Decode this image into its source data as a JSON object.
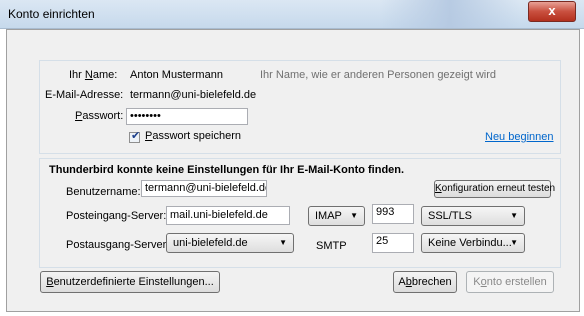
{
  "window": {
    "title": "Konto einrichten",
    "close_label": "x"
  },
  "identity": {
    "name_label_prefix": "Ihr ",
    "name_label_ul": "N",
    "name_label_rest": "ame:",
    "name_value": "Anton Mustermann",
    "name_hint": "Ihr Name, wie er anderen Personen gezeigt wird",
    "email_label": "E-Mail-Adresse:",
    "email_value": "termann@uni-bielefeld.de",
    "password_label_ul": "P",
    "password_label_rest": "asswort:",
    "password_value": "••••••••",
    "remember_label_ul": "P",
    "remember_label_rest": "asswort speichern",
    "remember_checked": true,
    "restart_link": "Neu beginnen"
  },
  "config": {
    "heading": "Thunderbird konnte keine Einstellungen für Ihr E-Mail-Konto finden.",
    "username_label": "Benutzername:",
    "username_value": "termann@uni-bielefeld.de",
    "retest_prefix": "",
    "retest_ul": "K",
    "retest_rest": "onfiguration erneut testen",
    "incoming_label": "Posteingang-Server:",
    "incoming_value": "mail.uni-bielefeld.de",
    "incoming_protocol": "IMAP",
    "incoming_port": "993",
    "incoming_security": "SSL/TLS",
    "outgoing_label": "Postausgang-Server:",
    "outgoing_value": "uni-bielefeld.de",
    "outgoing_protocol": "SMTP",
    "outgoing_port": "25",
    "outgoing_security": "Keine Verbindu..."
  },
  "footer": {
    "custom_ul": "B",
    "custom_rest": "enutzerdefinierte Einstellungen...",
    "cancel_prefix": "A",
    "cancel_ul": "b",
    "cancel_rest": "brechen",
    "create_prefix": "K",
    "create_ul": "o",
    "create_rest": "nto erstellen"
  }
}
